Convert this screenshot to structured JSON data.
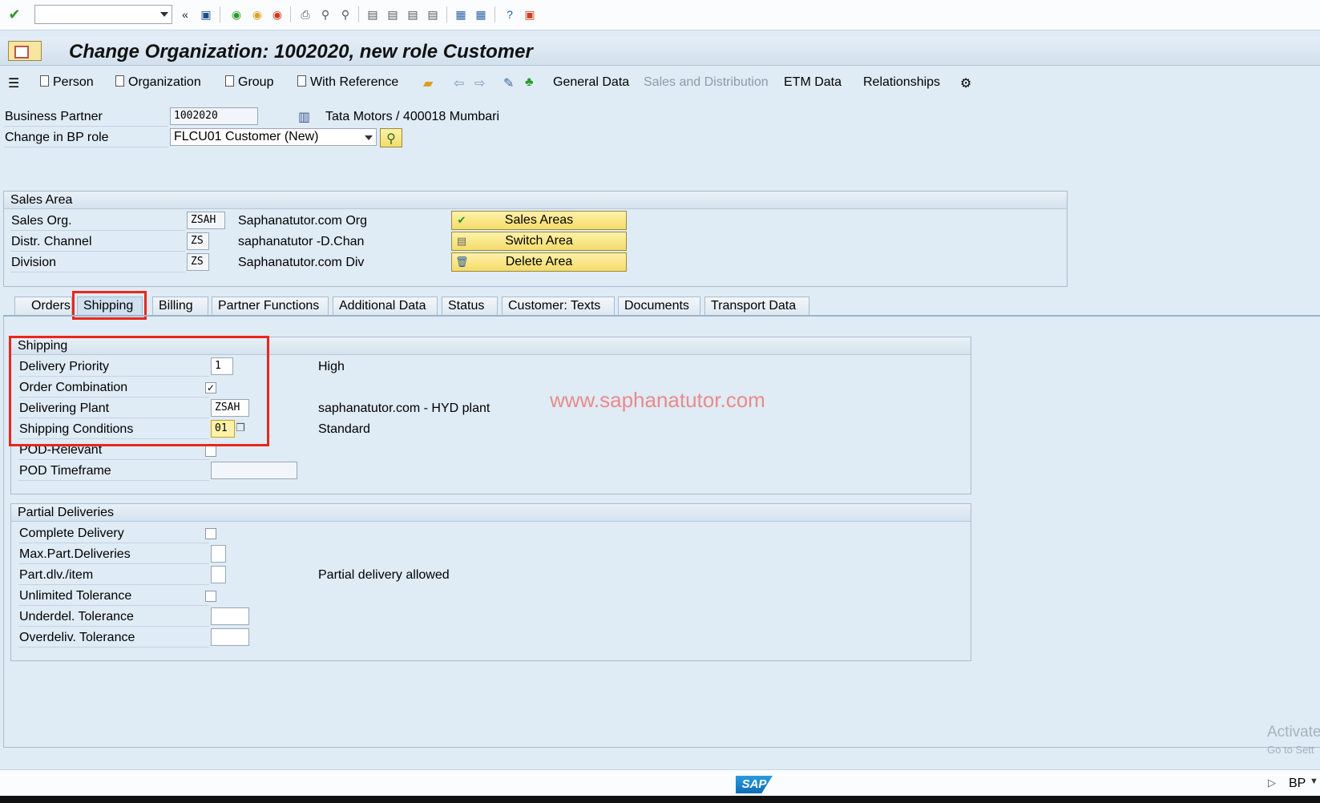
{
  "window": {
    "title": "Change Organization: 1002020, new role Customer"
  },
  "app_toolbar": {
    "person": "Person",
    "organization": "Organization",
    "group": "Group",
    "with_reference": "With Reference",
    "general_data": "General Data",
    "sales_distribution": "Sales and Distribution",
    "etm_data": "ETM Data",
    "relationships": "Relationships"
  },
  "header": {
    "bp_label": "Business Partner",
    "bp_value": "1002020",
    "bp_description": "Tata Motors / 400018 Mumbari",
    "role_label": "Change in BP role",
    "role_value": "FLCU01 Customer (New)"
  },
  "sales_area": {
    "title": "Sales Area",
    "rows": [
      {
        "label": "Sales Org.",
        "code": "ZSAH",
        "text": "Saphanatutor.com Org",
        "button": "Sales Areas"
      },
      {
        "label": "Distr. Channel",
        "code": "ZS",
        "text": "saphanatutor -D.Chan",
        "button": "Switch Area"
      },
      {
        "label": "Division",
        "code": "ZS",
        "text": "Saphanatutor.com Div",
        "button": "Delete Area"
      }
    ]
  },
  "tabs": [
    "Orders",
    "Shipping",
    "Billing",
    "Partner Functions",
    "Additional Data",
    "Status",
    "Customer: Texts",
    "Documents",
    "Transport Data"
  ],
  "active_tab": "Shipping",
  "shipping": {
    "title": "Shipping",
    "delivery_priority_label": "Delivery Priority",
    "delivery_priority_value": "1",
    "delivery_priority_text": "High",
    "order_combination_label": "Order Combination",
    "order_combination_checked": true,
    "delivering_plant_label": "Delivering Plant",
    "delivering_plant_value": "ZSAH",
    "delivering_plant_text": "saphanatutor.com - HYD plant",
    "shipping_conditions_label": "Shipping Conditions",
    "shipping_conditions_value": "01",
    "shipping_conditions_text": "Standard",
    "pod_relevant_label": "POD-Relevant",
    "pod_timeframe_label": "POD Timeframe"
  },
  "partial": {
    "title": "Partial Deliveries",
    "complete_delivery_label": "Complete Delivery",
    "max_part_label": "Max.Part.Deliveries",
    "part_dlv_label": "Part.dlv./item",
    "part_dlv_text": "Partial delivery allowed",
    "unlimited_tol_label": "Unlimited Tolerance",
    "underdel_label": "Underdel. Tolerance",
    "overdeliv_label": "Overdeliv. Tolerance"
  },
  "watermark": "www.saphanatutor.com",
  "activate_windows": {
    "line1": "Activate",
    "line2": "Go to Sett"
  },
  "status": {
    "sap_logo": "SAP",
    "transaction": "BP"
  }
}
